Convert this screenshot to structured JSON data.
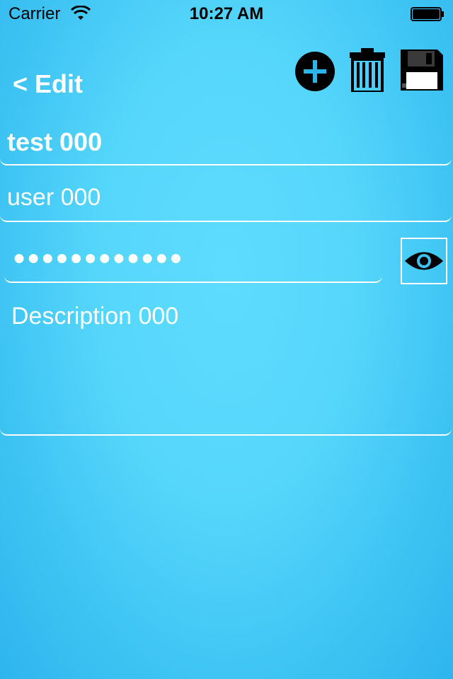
{
  "status_bar": {
    "carrier": "Carrier",
    "time": "10:27 AM"
  },
  "nav": {
    "back_label": "< Edit"
  },
  "toolbar": {
    "add_icon": "plus-circle-icon",
    "delete_icon": "trash-icon",
    "save_icon": "floppy-disk-icon"
  },
  "form": {
    "title_value": "test 000",
    "user_value": "user 000",
    "password_masked": "●●●●●●●●●●●●",
    "description_value": "Description 000",
    "toggle_visibility_icon": "eye-icon"
  },
  "colors": {
    "background": "#55d6fb",
    "text": "#ffffff"
  }
}
